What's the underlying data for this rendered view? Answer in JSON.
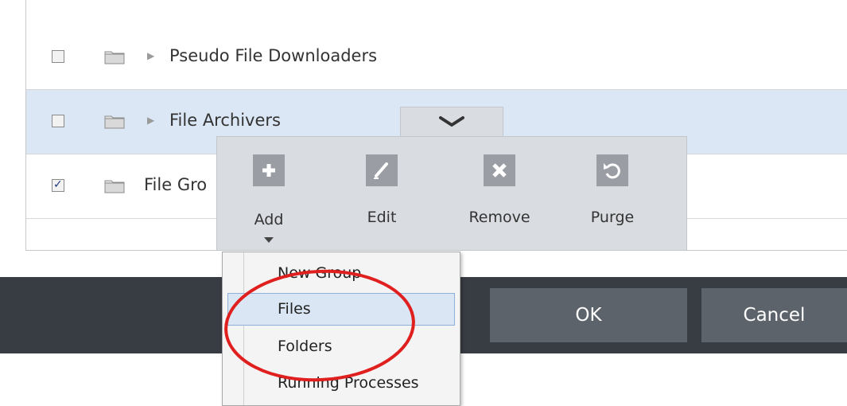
{
  "rows": [
    {
      "label": "Pseudo File Downloaders",
      "checked": false,
      "selected": false
    },
    {
      "label": "File Archivers",
      "checked": false,
      "selected": true
    },
    {
      "label": "File Gro",
      "checked": true,
      "selected": false
    }
  ],
  "toolbar": {
    "tools": [
      {
        "label": "Add",
        "icon": "plus-icon"
      },
      {
        "label": "Edit",
        "icon": "pencil-icon"
      },
      {
        "label": "Remove",
        "icon": "x-icon"
      },
      {
        "label": "Purge",
        "icon": "refresh-icon"
      }
    ]
  },
  "add_menu": {
    "items": [
      "New Group",
      "Files",
      "Folders",
      "Running Processes"
    ],
    "highlighted_index": 1
  },
  "footer": {
    "ok_label": "OK",
    "cancel_label": "Cancel"
  },
  "colors": {
    "selected_row": "#dbe7f4",
    "toolbar_bg": "#d9dce1",
    "bottom_bar": "#383d43",
    "button_bg": "#5d636b",
    "annotation": "#e01f1f"
  }
}
